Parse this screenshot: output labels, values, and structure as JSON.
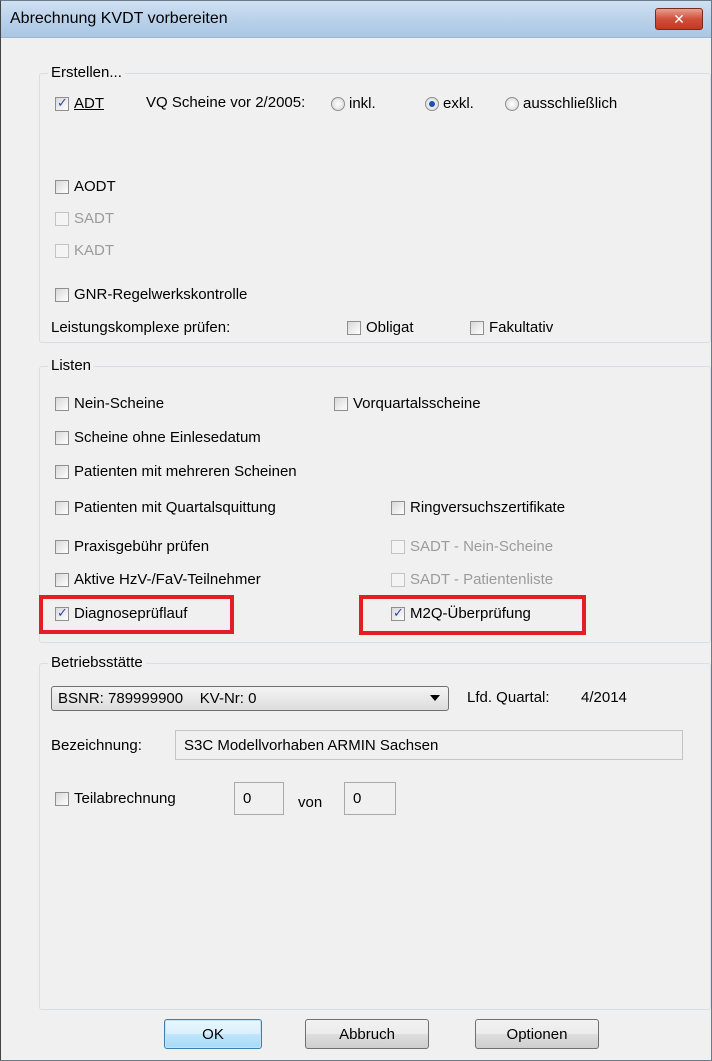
{
  "window": {
    "title": "Abrechnung KVDT vorbereiten",
    "close_glyph": "✕"
  },
  "erstellen": {
    "label": "Erstellen...",
    "adt": {
      "label": "ADT",
      "checked": true
    },
    "vq_label": "VQ Scheine vor 2/2005:",
    "vq_options": [
      {
        "label": "inkl.",
        "selected": false
      },
      {
        "label": "exkl.",
        "selected": true
      },
      {
        "label": "ausschließlich",
        "selected": false
      }
    ],
    "aodt": {
      "label": "AODT",
      "checked": false
    },
    "sadt": {
      "label": "SADT",
      "checked": false,
      "disabled": true
    },
    "kadt": {
      "label": "KADT",
      "checked": false,
      "disabled": true
    },
    "gnr": {
      "label": "GNR-Regelwerkskontrolle",
      "checked": false
    },
    "leistung_label": "Leistungskomplexe prüfen:",
    "obligat": {
      "label": "Obligat",
      "checked": false
    },
    "fakultativ": {
      "label": "Fakultativ",
      "checked": false
    }
  },
  "listen": {
    "label": "Listen",
    "nein_scheine": {
      "label": "Nein-Scheine",
      "checked": false
    },
    "vorquartal": {
      "label": "Vorquartalsscheine",
      "checked": false
    },
    "ohne_einlese": {
      "label": "Scheine ohne Einlesedatum",
      "checked": false
    },
    "mehrere": {
      "label": "Patienten mit mehreren Scheinen",
      "checked": false
    },
    "quittung": {
      "label": "Patienten mit Quartalsquittung",
      "checked": false
    },
    "ring": {
      "label": "Ringversuchszertifikate",
      "checked": false
    },
    "praxis": {
      "label": "Praxisgebühr prüfen",
      "checked": false
    },
    "sadt_nein": {
      "label": "SADT - Nein-Scheine",
      "checked": false,
      "disabled": true
    },
    "hzv": {
      "label": "Aktive HzV-/FaV-Teilnehmer",
      "checked": false
    },
    "sadt_patient": {
      "label": "SADT - Patientenliste",
      "checked": false,
      "disabled": true
    },
    "diagnose": {
      "label": "Diagnoseprüflauf",
      "checked": true
    },
    "m2q": {
      "label": "M2Q-Überprüfung",
      "checked": true
    }
  },
  "betrieb": {
    "label": "Betriebsstätte",
    "bsnr_value": "BSNR: 789999900    KV-Nr: 0",
    "lfd_label": "Lfd. Quartal:",
    "lfd_value": "4/2014",
    "bezeichnung_label": "Bezeichnung:",
    "bezeichnung_value": "S3C Modellvorhaben ARMIN Sachsen",
    "teil": {
      "label": "Teilabrechnung",
      "checked": false
    },
    "teil_from": "0",
    "von_label": "von",
    "teil_to": "0"
  },
  "buttons": {
    "ok": "OK",
    "abbruch": "Abbruch",
    "optionen": "Optionen"
  },
  "colors": {
    "highlight": "#e41e26",
    "checkmark": "#2b49a0",
    "title_bar": "#b9d1ea"
  }
}
